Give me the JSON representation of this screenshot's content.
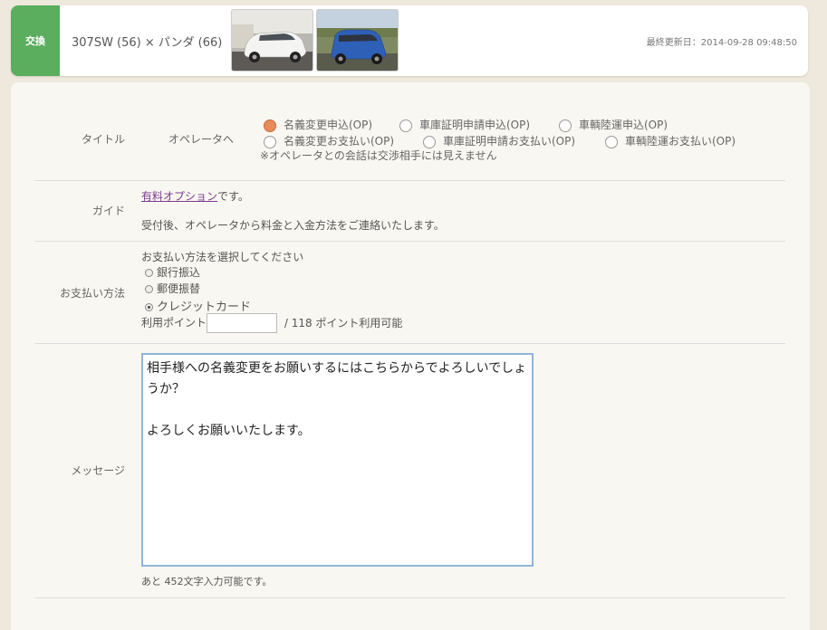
{
  "header": {
    "badge": "交換",
    "trade_title": "307SW (56) × パンダ (66)",
    "updated": "最終更新日：2014-09-28 09:48:50"
  },
  "rows": {
    "title": {
      "label": "タイトル",
      "operator_label": "オペレータへ",
      "options": [
        "名義変更申込(OP)",
        "車庫証明申請申込(OP)",
        "車輌陸運申込(OP)",
        "名義変更お支払い(OP)",
        "車庫証明申請お支払い(OP)",
        "車輌陸運お支払い(OP)"
      ],
      "selected": "名義変更申込(OP)",
      "note": "※オペレータとの会話は交渉相手には見えません"
    },
    "guide": {
      "label": "ガイド",
      "link": "有料オプション",
      "link_suffix": "です。",
      "text": "受付後、オペレータから料金と入金方法をご連絡いたします。"
    },
    "payment": {
      "label": "お支払い方法",
      "prompt": "お支払い方法を選択してください",
      "options": [
        "銀行振込",
        "郵便振替",
        "クレジットカード"
      ],
      "selected": "クレジットカード",
      "points_label": "利用ポイント",
      "points_value": "",
      "points_available": "/ 118 ポイント利用可能"
    },
    "message": {
      "label": "メッセージ",
      "text": "相手様への名義変更をお願いするにはこちらからでよろしいでしょうか？\n\nよろしくお願いいたします。",
      "remaining": "あと 452文字入力可能です。"
    }
  },
  "colors": {
    "badge": "#5aae5e",
    "selected_radio": "#e88a5a",
    "link": "#7b3b91",
    "textarea_border": "#8fb5d9"
  }
}
